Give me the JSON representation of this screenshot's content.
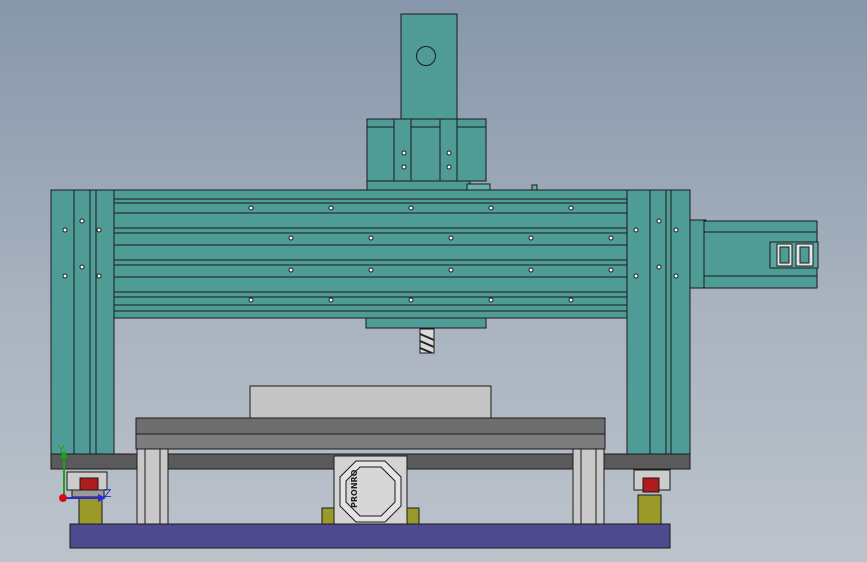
{
  "colors": {
    "frame": "#4e9c95",
    "frame_dark": "#3d807a",
    "base_plate": "#4d4a8e",
    "table_grey": "#6e6e6e",
    "workpiece": "#c4c4c4",
    "foot_yellow": "#9a9a2a",
    "foot_red": "#b01b1b",
    "rail_grey": "#b9b9b9",
    "outline": "#1a1a1a"
  },
  "icons": {
    "triad": "coordinate-triad-icon",
    "spindle_tool": "end-mill-icon",
    "motor_logo": "motor-logo-icon"
  },
  "triad": {
    "y_label": "Y",
    "z_label": "Z"
  },
  "motor": {
    "logo_text": "PRONRO"
  }
}
